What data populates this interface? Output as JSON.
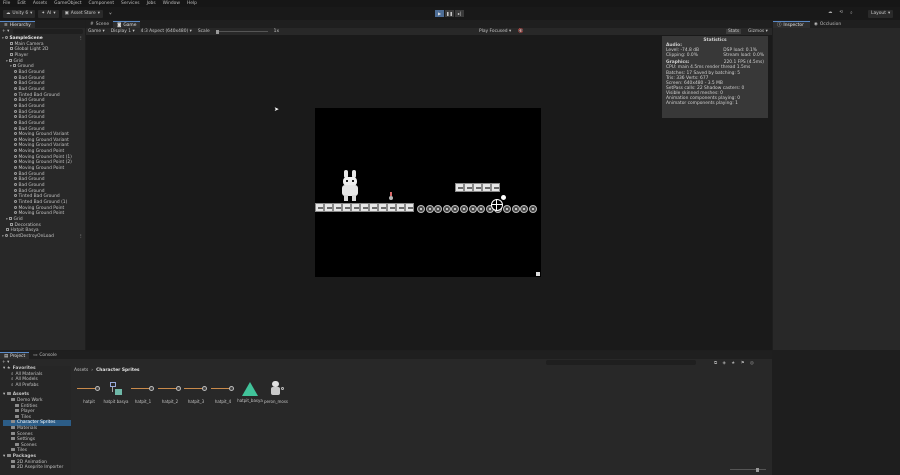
{
  "menu": [
    "File",
    "Edit",
    "Assets",
    "GameObject",
    "Component",
    "Services",
    "Jobs",
    "Window",
    "Help"
  ],
  "toolbar": {
    "account": "Unity 6",
    "ai": "AI",
    "asset_store": "Asset Store",
    "layout": "Layout"
  },
  "hierarchy": {
    "tab": "Hierarchy",
    "rows": [
      {
        "label": "SampleScene",
        "depth": 0,
        "kind": "scene",
        "bold": true
      },
      {
        "label": "Main Camera",
        "depth": 2,
        "kind": "cube"
      },
      {
        "label": "Global Light 2D",
        "depth": 2,
        "kind": "cube"
      },
      {
        "label": "Player",
        "depth": 2,
        "kind": "cube"
      },
      {
        "label": "Grid",
        "depth": 1,
        "kind": "cube",
        "expand": true
      },
      {
        "label": "Ground",
        "depth": 2,
        "kind": "cube",
        "expand": true
      },
      {
        "label": "Bad Ground",
        "depth": 3,
        "kind": "obj"
      },
      {
        "label": "Bad Ground",
        "depth": 3,
        "kind": "obj"
      },
      {
        "label": "Bad Ground",
        "depth": 3,
        "kind": "obj"
      },
      {
        "label": "Bad Ground",
        "depth": 3,
        "kind": "obj"
      },
      {
        "label": "Tinted Bad Ground",
        "depth": 3,
        "kind": "obj"
      },
      {
        "label": "Bad Ground",
        "depth": 3,
        "kind": "obj"
      },
      {
        "label": "Bad Ground",
        "depth": 3,
        "kind": "obj"
      },
      {
        "label": "Bad Ground",
        "depth": 3,
        "kind": "obj"
      },
      {
        "label": "Bad Ground",
        "depth": 3,
        "kind": "obj"
      },
      {
        "label": "Bad Ground",
        "depth": 3,
        "kind": "obj"
      },
      {
        "label": "Bad Ground",
        "depth": 3,
        "kind": "obj"
      },
      {
        "label": "Moving Ground Variant",
        "depth": 3,
        "kind": "obj"
      },
      {
        "label": "Moving Ground Variant",
        "depth": 3,
        "kind": "obj"
      },
      {
        "label": "Moving Ground Variant",
        "depth": 3,
        "kind": "obj"
      },
      {
        "label": "Moving Ground Point",
        "depth": 3,
        "kind": "obj"
      },
      {
        "label": "Moving Ground Point (1)",
        "depth": 3,
        "kind": "obj"
      },
      {
        "label": "Moving Ground Point (2)",
        "depth": 3,
        "kind": "obj"
      },
      {
        "label": "Moving Ground Point",
        "depth": 3,
        "kind": "obj"
      },
      {
        "label": "Bad Ground",
        "depth": 3,
        "kind": "obj"
      },
      {
        "label": "Bad Ground",
        "depth": 3,
        "kind": "obj"
      },
      {
        "label": "Bad Ground",
        "depth": 3,
        "kind": "obj"
      },
      {
        "label": "Bad Ground",
        "depth": 3,
        "kind": "obj"
      },
      {
        "label": "Tinted Bad Ground",
        "depth": 3,
        "kind": "obj"
      },
      {
        "label": "Tinted Bad Ground (1)",
        "depth": 3,
        "kind": "obj"
      },
      {
        "label": "Moving Ground Point",
        "depth": 3,
        "kind": "obj"
      },
      {
        "label": "Moving Ground Point",
        "depth": 3,
        "kind": "obj"
      },
      {
        "label": "Grid",
        "depth": 1,
        "kind": "cube",
        "expand": true
      },
      {
        "label": "Decorations",
        "depth": 2,
        "kind": "cube"
      },
      {
        "label": "Hatpit Basya",
        "depth": 1,
        "kind": "cube"
      },
      {
        "label": "DontDestroyOnLoad",
        "depth": 0,
        "kind": "scene",
        "bold": false
      }
    ]
  },
  "center": {
    "tabs": [
      "Scene",
      "Game"
    ],
    "active_tab": "Game",
    "game_bar": {
      "display_mode": "Game",
      "display": "Display 1",
      "aspect": "4:3 Aspect (640x480)",
      "scale_label": "Scale",
      "scale_value": "1x",
      "play_mode": "Play Focused",
      "stats": "Stats",
      "gizmos": "Gizmos"
    }
  },
  "stats": {
    "title": "Statistics",
    "audio_heading": "Audio:",
    "audio_left": [
      "Level: -74.8 dB",
      "Clipping: 0.0%"
    ],
    "audio_right": [
      "DSP load: 0.1%",
      "Stream load: 0.0%"
    ],
    "graphics_heading": "Graphics:",
    "fps": "220.1 FPS (4.5ms)",
    "graphics_lines": [
      "CPU: main 4.5ms  render thread 1.5ms",
      "Batches: 17    Saved by batching: 5",
      "Tris: 336   Verts: 677",
      "Screen: 640x480 - 3.5 MB",
      "SetPass calls: 22     Shadow casters: 0",
      "Visible skinned meshes: 0",
      "Animation components playing: 0",
      "Animator components playing: 1"
    ]
  },
  "inspector_tab": "Inspector",
  "occlusion_tab": "Occlusion",
  "project": {
    "tabs": [
      "Project",
      "Console"
    ],
    "breadcrumb": [
      "Assets",
      "Character Sprites"
    ],
    "favorites_label": "Favorites",
    "favorites": [
      "All Materials",
      "All Models",
      "All Prefabs"
    ],
    "assets_label": "Assets",
    "folders": [
      {
        "label": "Demo Work",
        "depth": 1
      },
      {
        "label": "Entities",
        "depth": 2
      },
      {
        "label": "Player",
        "depth": 2
      },
      {
        "label": "Tiles",
        "depth": 2
      },
      {
        "label": "Character Sprites",
        "depth": 1,
        "selected": true
      },
      {
        "label": "Materials",
        "depth": 1
      },
      {
        "label": "Scenes",
        "depth": 1
      },
      {
        "label": "Settings",
        "depth": 1
      },
      {
        "label": "Scenes",
        "depth": 2
      },
      {
        "label": "Tiles",
        "depth": 1
      }
    ],
    "packages_label": "Packages",
    "packages": [
      "2D Animation",
      "2D Aseprite Importer"
    ],
    "assets": [
      "hatpit",
      "hatpit basya",
      "hatpit_1",
      "hatpit_2",
      "hatpit_3",
      "hatpit_4",
      "hatpit_basya",
      "peron_moss"
    ]
  },
  "colors": {
    "accent": "#4d6d96",
    "selection": "#2c5d87"
  }
}
